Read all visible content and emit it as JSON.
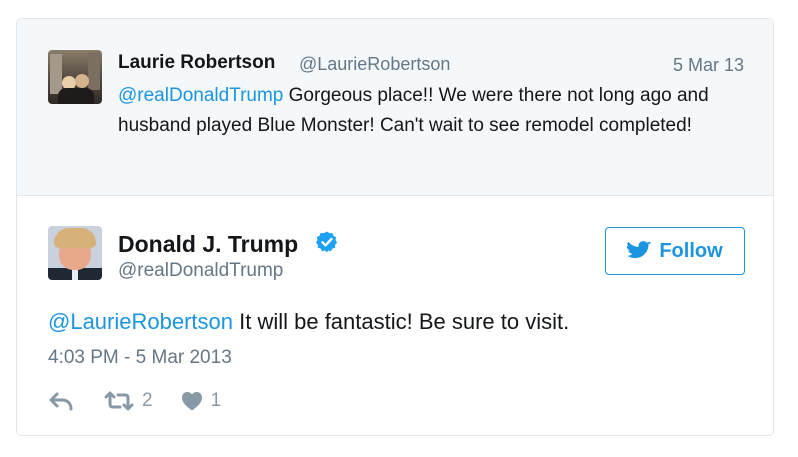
{
  "reply_context": {
    "author_name": "Laurie Robertson",
    "author_handle": "@LaurieRobertson",
    "date": "5 Mar 13",
    "mention": "@realDonaldTrump",
    "text": " Gorgeous place!! We were there not long ago and husband played Blue Monster! Can't wait to see remodel completed!"
  },
  "tweet": {
    "author_name": "Donald J. Trump",
    "author_handle": "@realDonaldTrump",
    "verified": true,
    "follow_label": "Follow",
    "mention": "@LaurieRobertson",
    "text": " It will be fantastic! Be sure to visit.",
    "timestamp": "4:03 PM - 5 Mar 2013",
    "retweet_count": "2",
    "like_count": "1"
  },
  "colors": {
    "link": "#1b95e0",
    "muted": "#657786",
    "icon": "#8899a6",
    "context_bg": "#f5f8fa",
    "border": "#e1e8ed"
  },
  "icons": {
    "reply": "reply-arrow-icon",
    "retweet": "retweet-icon",
    "like": "heart-icon",
    "follow": "twitter-bird-icon",
    "verified": "verified-badge-icon"
  }
}
